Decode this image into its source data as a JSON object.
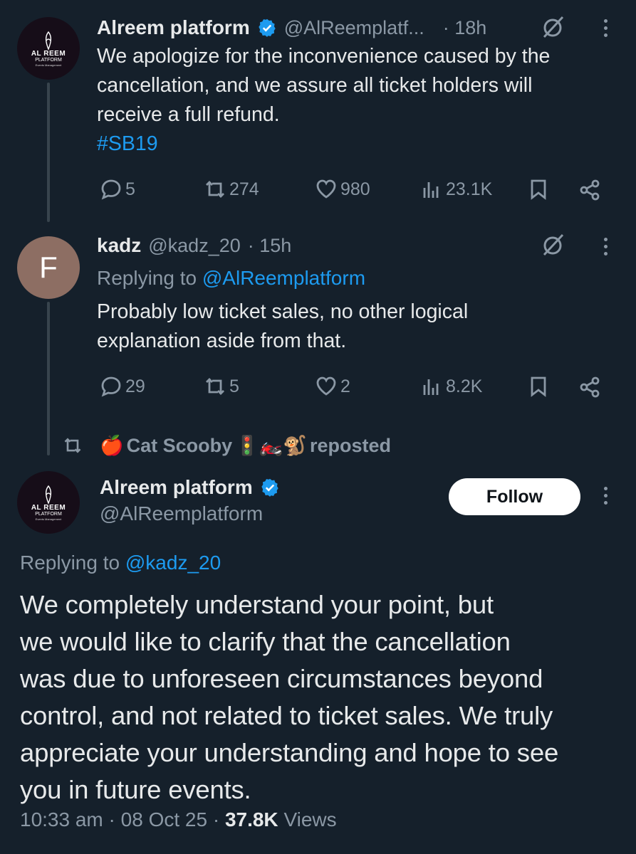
{
  "tweet1": {
    "name": "Alreem platform",
    "handle": "@AlReemplatf...",
    "time": "· 18h",
    "text_lines": [
      "We apologize for the inconvenience caused by the",
      "cancellation, and we assure all ticket holders will",
      "receive a full refund."
    ],
    "hashtag": "#SB19",
    "stats": {
      "replies": "5",
      "reposts": "274",
      "likes": "980",
      "views": "23.1K"
    },
    "avatar_text": [
      "AL REEM",
      "PLATFORM",
      "Events Management"
    ]
  },
  "tweet2": {
    "avatar_letter": "F",
    "name": "kadz",
    "handle": "@kadz_20",
    "time": "· 15h",
    "replying_prefix": "Replying to",
    "replying_to": "@AlReemplatform",
    "text_lines": [
      "Probably low ticket sales, no other logical",
      "explanation aside from that."
    ],
    "stats": {
      "replies": "29",
      "reposts": "5",
      "likes": "2",
      "views": "8.2K"
    }
  },
  "repost_bar": {
    "apple_emoji": "🍎",
    "name": "Cat Scooby",
    "emojis": "🚦🏍️🐒",
    "suffix": "reposted"
  },
  "main_tweet": {
    "name": "Alreem platform",
    "handle": "@AlReemplatform",
    "follow_label": "Follow",
    "replying_prefix": "Replying to",
    "replying_to": "@kadz_20",
    "text_lines": [
      "We completely understand your point, but",
      "we would like to clarify that the cancellation",
      "was due to unforeseen circumstances beyond",
      "control, and not related to ticket sales. We truly",
      "appreciate your understanding and hope to see",
      "you in future events."
    ],
    "time": "10:33 am",
    "date": "08 Oct 25",
    "views_count": "37.8K",
    "views_label": "Views"
  },
  "colors": {
    "background": "#15202b",
    "accent": "#1d9bf0",
    "muted": "#8b98a5",
    "text": "#e7e9ea"
  }
}
